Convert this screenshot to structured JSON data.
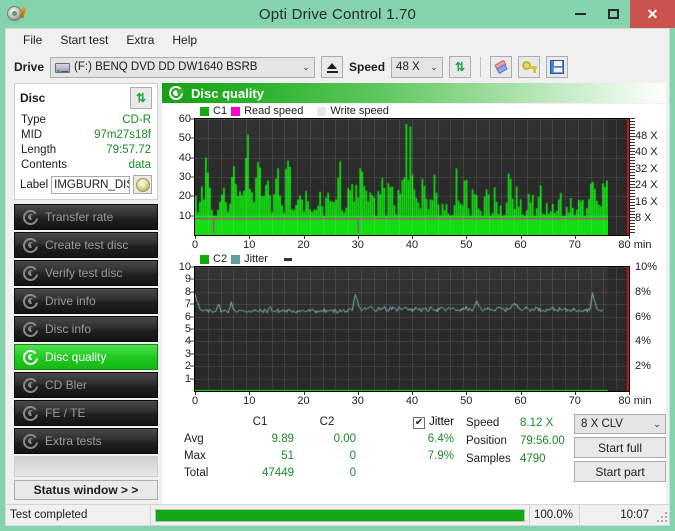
{
  "window": {
    "title": "Opti Drive Control 1.70",
    "icon": "disc-pen-icon",
    "minimize_label": "—",
    "maximize_label": "□",
    "close_label": "✕",
    "titlebar_color": "#84d3ad",
    "close_color": "#c9524f"
  },
  "menu": {
    "items": [
      {
        "label": "File",
        "name": "menu-file"
      },
      {
        "label": "Start test",
        "name": "menu-start-test"
      },
      {
        "label": "Extra",
        "name": "menu-extra"
      },
      {
        "label": "Help",
        "name": "menu-help"
      }
    ]
  },
  "toolbar": {
    "drive_label": "Drive",
    "drive_value": "(F:)   BENQ DVD DD DW1640 BSRB",
    "drive_icon": "optical-drive-icon",
    "eject_icon": "eject-icon",
    "speed_label": "Speed",
    "speed_value": "48 X",
    "refresh_icon": "refresh-icon",
    "erase_icon": "eraser-icon",
    "key_icon": "key-icon",
    "save_icon": "save-floppy-icon",
    "dropdown_arrow": "chevron-down-icon"
  },
  "disc_panel": {
    "title": "Disc",
    "refresh_icon": "refresh-icon",
    "rows": [
      {
        "key": "Type",
        "value": "CD-R"
      },
      {
        "key": "MID",
        "value": "97m27s18f"
      },
      {
        "key": "Length",
        "value": "79:57.72"
      },
      {
        "key": "Contents",
        "value": "data"
      }
    ],
    "label_key": "Label",
    "label_value": "IMGBURN_DIS",
    "disc_icon": "cd-disc-icon"
  },
  "sidebar": {
    "items": [
      {
        "label": "Transfer rate",
        "name": "sidebar-item-transfer-rate",
        "active": false
      },
      {
        "label": "Create test disc",
        "name": "sidebar-item-create-test-disc",
        "active": false
      },
      {
        "label": "Verify test disc",
        "name": "sidebar-item-verify-test-disc",
        "active": false
      },
      {
        "label": "Drive info",
        "name": "sidebar-item-drive-info",
        "active": false
      },
      {
        "label": "Disc info",
        "name": "sidebar-item-disc-info",
        "active": false
      },
      {
        "label": "Disc quality",
        "name": "sidebar-item-disc-quality",
        "active": true
      },
      {
        "label": "CD Bler",
        "name": "sidebar-item-cd-bler",
        "active": false
      },
      {
        "label": "FE / TE",
        "name": "sidebar-item-fe-te",
        "active": false
      },
      {
        "label": "Extra tests",
        "name": "sidebar-item-extra-tests",
        "active": false
      }
    ],
    "status_window_label": "Status window > >",
    "active_color": "#22c922"
  },
  "panel": {
    "title": "Disc quality",
    "icon": "disc-quality-icon"
  },
  "chart_data": [
    {
      "type": "bar",
      "name": "c1-chart",
      "title": "",
      "legend": [
        {
          "label": "C1",
          "color": "#11aa11"
        },
        {
          "label": "Read speed",
          "color": "#ff00cc"
        },
        {
          "label": "Write speed",
          "color": "#e8e8e8"
        }
      ],
      "legend_position": "top-left",
      "grid": true,
      "xlabel": "min",
      "xlim": [
        0,
        80
      ],
      "xticks": [
        0,
        10,
        20,
        30,
        40,
        50,
        60,
        70,
        80
      ],
      "ylabel": "",
      "ylim": [
        0,
        60
      ],
      "yticks": [
        10,
        20,
        30,
        40,
        50,
        60
      ],
      "y2label": "",
      "y2lim": [
        0,
        56
      ],
      "y2ticks": [
        8,
        16,
        24,
        32,
        40,
        48
      ],
      "y2ticklabels": [
        "8 X",
        "16 X",
        "24 X",
        "32 X",
        "40 X",
        "48 X"
      ],
      "read_speed_value": 8.12,
      "series": [
        {
          "name": "C1",
          "color": "#11dd11",
          "x": [
            0,
            0.5,
            1,
            1.5,
            2,
            2.5,
            3,
            3.5,
            4,
            4.5,
            5,
            5.5,
            6,
            6.5,
            7,
            7.5,
            8,
            8.5,
            9,
            9.5,
            10,
            10.5,
            11,
            11.5,
            12,
            12.5,
            13,
            13.5,
            14,
            14.5,
            15,
            15.5,
            16,
            16.5,
            17,
            17.5,
            18,
            18.5,
            19,
            19.5,
            20,
            20.5,
            21,
            21.5,
            22,
            22.5,
            23,
            23.5,
            24,
            24.5,
            25,
            25.5,
            26,
            26.5,
            27,
            27.5,
            28,
            28.5,
            29,
            29.5,
            30,
            30.5,
            31,
            31.5,
            32,
            32.5,
            33,
            33.5,
            34,
            34.5,
            35,
            35.5,
            36,
            36.5,
            37,
            37.5,
            38,
            38.5,
            39,
            39.5,
            40,
            40.5,
            41,
            41.5,
            42,
            42.5,
            43,
            43.5,
            44,
            44.5,
            45,
            45.5,
            46,
            46.5,
            47,
            47.5,
            48,
            48.5,
            49,
            49.5,
            50,
            50.5,
            51,
            51.5,
            52,
            52.5,
            53,
            53.5,
            54,
            54.5,
            55,
            55.5,
            56,
            56.5,
            57,
            57.5,
            58,
            58.5,
            59,
            59.5,
            60,
            60.5,
            61,
            61.5,
            62,
            62.5,
            63,
            63.5,
            64,
            64.5,
            65,
            65.5,
            66,
            66.5,
            67,
            67.5,
            68,
            68.5,
            69,
            69.5,
            70,
            70.5,
            71,
            71.5,
            72,
            72.5,
            73,
            73.5,
            74,
            74.5,
            75,
            75.5,
            76,
            76.5,
            77,
            77.5,
            78,
            78.5,
            79,
            79.5,
            80
          ],
          "values": [
            20,
            13,
            17,
            29,
            36,
            26,
            20,
            14,
            7,
            22,
            31,
            20,
            12,
            25,
            42,
            31,
            16,
            21,
            27,
            37,
            47,
            33,
            23,
            30,
            42,
            29,
            18,
            24,
            33,
            20,
            14,
            26,
            34,
            22,
            15,
            28,
            39,
            25,
            17,
            22,
            31,
            21,
            13,
            19,
            26,
            18,
            11,
            20,
            29,
            20,
            12,
            22,
            30,
            21,
            14,
            25,
            34,
            23,
            15,
            21,
            42,
            28,
            18,
            24,
            36,
            25,
            16,
            22,
            30,
            19,
            13,
            24,
            35,
            22,
            15,
            26,
            34,
            23,
            14,
            20,
            29,
            21,
            48,
            51,
            38,
            30,
            22,
            16,
            24,
            33,
            21,
            13,
            20,
            26,
            17,
            11,
            18,
            24,
            16,
            10,
            17,
            33,
            22,
            14,
            20,
            28,
            18,
            12,
            22,
            30,
            20,
            13,
            19,
            26,
            17,
            11,
            18,
            25,
            16,
            10,
            17,
            24,
            34,
            22,
            14,
            20,
            27,
            18,
            12,
            19,
            26,
            17,
            11,
            18,
            25,
            16,
            10,
            16,
            22,
            15,
            9,
            15,
            21,
            14,
            9,
            16,
            23,
            15,
            10,
            17,
            24,
            16,
            11,
            19,
            38,
            30,
            20,
            13,
            19,
            28,
            22
          ]
        }
      ]
    },
    {
      "type": "line",
      "name": "c2-jitter-chart",
      "title": "",
      "legend": [
        {
          "label": "C2",
          "color": "#11aa11"
        },
        {
          "label": "Jitter",
          "color": "#5f9ea0"
        }
      ],
      "legend_position": "top-left",
      "grid": true,
      "xlabel": "min",
      "xlim": [
        0,
        80
      ],
      "xticks": [
        0,
        10,
        20,
        30,
        40,
        50,
        60,
        70,
        80
      ],
      "ylim": [
        0,
        10
      ],
      "yticks": [
        1,
        2,
        3,
        4,
        5,
        6,
        7,
        8,
        9,
        10
      ],
      "y2lim": [
        0,
        10
      ],
      "y2ticks": [
        2,
        4,
        6,
        8,
        10
      ],
      "y2ticklabels": [
        "2%",
        "4%",
        "6%",
        "8%",
        "10%"
      ],
      "series": [
        {
          "name": "Jitter",
          "color": "#7fb3b5",
          "x": [
            0,
            0.5,
            1,
            1.5,
            2,
            2.5,
            3,
            3.5,
            4,
            4.5,
            5,
            5.5,
            6,
            6.5,
            7,
            7.5,
            8,
            8.5,
            9,
            9.5,
            10,
            10.5,
            11,
            11.5,
            12,
            12.5,
            13,
            13.5,
            14,
            14.5,
            15,
            15.5,
            16,
            16.5,
            17,
            17.5,
            18,
            18.5,
            19,
            19.5,
            20,
            20.5,
            21,
            21.5,
            22,
            22.5,
            23,
            23.5,
            24,
            24.5,
            25,
            25.5,
            26,
            26.5,
            27,
            27.5,
            28,
            28.5,
            29,
            29.5,
            30,
            30.5,
            31,
            31.5,
            32,
            32.5,
            33,
            33.5,
            34,
            34.5,
            35,
            35.5,
            36,
            36.5,
            37,
            37.5,
            38,
            38.5,
            39,
            39.5,
            40,
            40.5,
            41,
            41.5,
            42,
            42.5,
            43,
            43.5,
            44,
            44.5,
            45,
            45.5,
            46,
            46.5,
            47,
            47.5,
            48,
            48.5,
            49,
            49.5,
            50,
            50.5,
            51,
            51.5,
            52,
            52.5,
            53,
            53.5,
            54,
            54.5,
            55,
            55.5,
            56,
            56.5,
            57,
            57.5,
            58,
            58.5,
            59,
            59.5,
            60,
            60.5,
            61,
            61.5,
            62,
            62.5,
            63,
            63.5,
            64,
            64.5,
            65,
            65.5,
            66,
            66.5,
            67,
            67.5,
            68,
            68.5,
            69,
            69.5,
            70,
            70.5,
            71,
            71.5,
            72,
            72.5,
            73,
            73.5,
            74,
            74.5,
            75,
            75.5,
            76,
            76.5,
            77,
            77.5,
            78,
            78.5,
            79,
            79.5,
            80
          ],
          "values": [
            7.9,
            7.2,
            6.5,
            6.4,
            6.5,
            6.4,
            6.5,
            6.4,
            6.5,
            7.0,
            6.5,
            6.4,
            6.5,
            6.4,
            7.1,
            6.6,
            6.4,
            6.5,
            6.4,
            6.5,
            6.4,
            6.5,
            6.4,
            6.5,
            6.4,
            6.5,
            6.4,
            6.5,
            6.4,
            6.8,
            6.5,
            6.4,
            6.5,
            6.4,
            6.5,
            6.4,
            6.5,
            6.4,
            6.5,
            6.4,
            6.5,
            6.4,
            6.5,
            6.4,
            6.5,
            6.4,
            6.5,
            6.4,
            6.5,
            6.4,
            6.5,
            6.4,
            6.5,
            6.4,
            6.5,
            6.4,
            6.5,
            6.4,
            6.5,
            6.4,
            6.5,
            6.4,
            7.8,
            7.2,
            6.6,
            6.5,
            6.7,
            6.6,
            6.8,
            6.6,
            6.5,
            6.7,
            6.6,
            6.8,
            6.6,
            6.5,
            6.7,
            6.6,
            6.5,
            6.7,
            6.6,
            6.8,
            6.7,
            6.6,
            6.5,
            6.6,
            6.7,
            6.6,
            6.5,
            6.6,
            6.5,
            6.6,
            6.7,
            6.6,
            6.5,
            6.7,
            6.6,
            6.5,
            6.6,
            6.7,
            6.6,
            6.5,
            6.6,
            6.5,
            6.6,
            6.7,
            6.6,
            6.5,
            6.6,
            7.2,
            6.8,
            6.6,
            6.5,
            6.6,
            6.7,
            6.6,
            6.5,
            6.6,
            6.7,
            6.6,
            6.5,
            6.6,
            6.7,
            6.9,
            7.0,
            6.8,
            6.7,
            6.6,
            6.7,
            6.6,
            6.5,
            6.6,
            6.7,
            6.6,
            6.5,
            6.6,
            6.5,
            6.6,
            6.7,
            6.6,
            6.5,
            6.6,
            6.5,
            6.6,
            6.5,
            6.6,
            6.5,
            6.6,
            6.5,
            6.6,
            6.5,
            6.6,
            6.5,
            6.6,
            7.9,
            7.0,
            6.6,
            6.4,
            6.5
          ]
        },
        {
          "name": "C2",
          "color": "#11dd11",
          "x": [
            0,
            80
          ],
          "values": [
            0,
            0
          ]
        }
      ]
    }
  ],
  "stats": {
    "headers": [
      "",
      "C1",
      "C2",
      "",
      "Jitter"
    ],
    "jitter_checked": true,
    "jitter_label": "Jitter",
    "check_glyph": "✔",
    "rows": [
      {
        "key": "Avg",
        "c1": "9.89",
        "c2": "0.00",
        "jitter": "6.4%"
      },
      {
        "key": "Max",
        "c1": "51",
        "c2": "0",
        "jitter": "7.9%"
      },
      {
        "key": "Total",
        "c1": "47449",
        "c2": "0",
        "jitter": ""
      }
    ]
  },
  "readout": {
    "speed_key": "Speed",
    "speed_value": "8.12 X",
    "position_key": "Position",
    "position_value": "79:56.00",
    "samples_key": "Samples",
    "samples_value": "4790",
    "speed_select_value": "8 X CLV",
    "start_full_label": "Start full",
    "start_part_label": "Start part"
  },
  "statusbar": {
    "text": "Test completed",
    "progress_percent": 100.0,
    "percent_label": "100.0%",
    "time": "10:07",
    "progress_color": "#13a813"
  }
}
